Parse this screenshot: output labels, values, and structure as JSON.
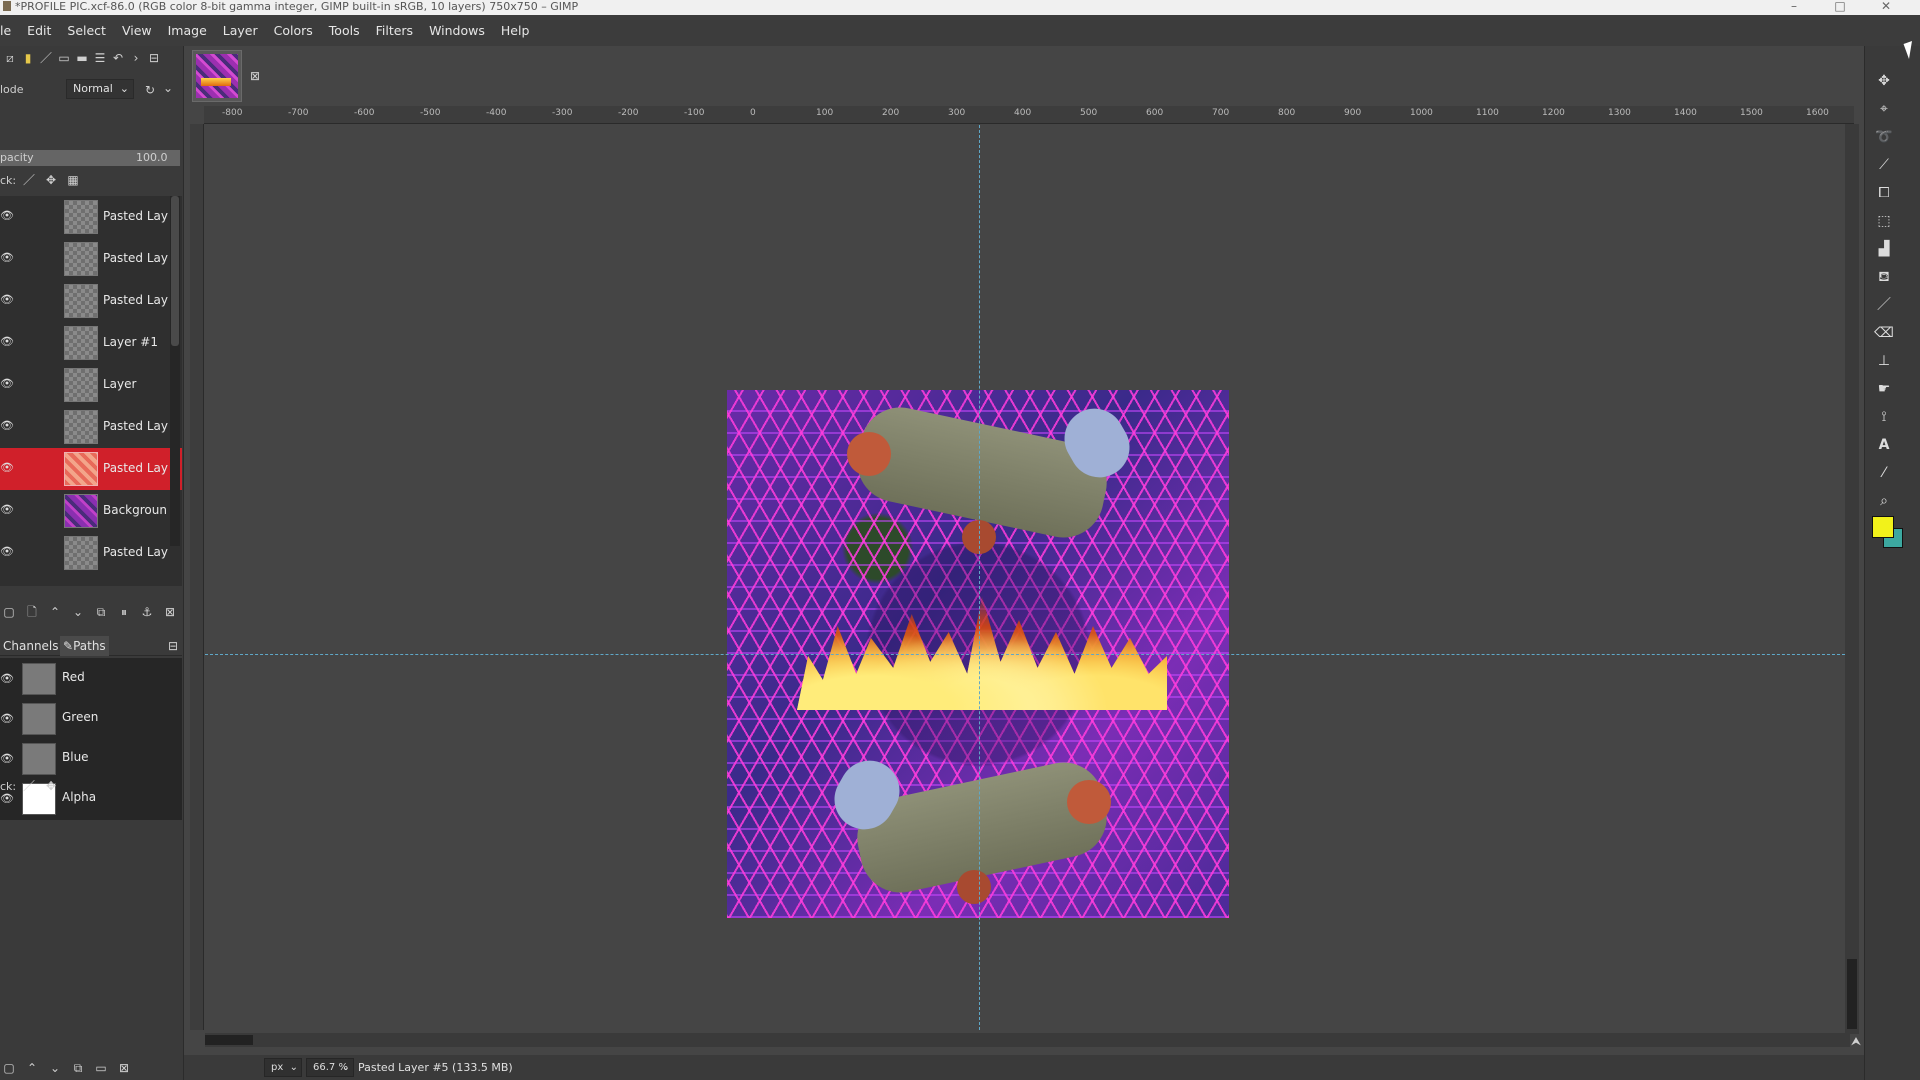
{
  "window": {
    "title": "*PROFILE PIC.xcf-86.0 (RGB color 8-bit gamma integer, GIMP built-in sRGB, 10 layers) 750x750 – GIMP",
    "controls": {
      "minimize": "–",
      "maximize": "□",
      "close": "✕"
    }
  },
  "menubar": {
    "items": [
      "le",
      "Edit",
      "Select",
      "View",
      "Image",
      "Layer",
      "Colors",
      "Tools",
      "Filters",
      "Windows",
      "Help"
    ]
  },
  "layers_panel": {
    "mode_label": "lode",
    "mode_value": "Normal",
    "opacity_label": "pacity",
    "opacity_value": "100.0",
    "opacity_fraction": 1.0,
    "lock_label": "ck:",
    "layers": [
      {
        "name": "Pasted Lay",
        "visible": true,
        "active": false
      },
      {
        "name": "Pasted Lay",
        "visible": true,
        "active": false
      },
      {
        "name": "Pasted Lay",
        "visible": true,
        "active": false
      },
      {
        "name": "Layer #1",
        "visible": true,
        "active": false
      },
      {
        "name": "Layer",
        "visible": true,
        "active": false
      },
      {
        "name": "Pasted Lay",
        "visible": true,
        "active": false
      },
      {
        "name": "Pasted Lay",
        "visible": true,
        "active": true
      },
      {
        "name": "Backgroun",
        "visible": true,
        "active": false
      },
      {
        "name": "Pasted Lay",
        "visible": true,
        "active": false
      }
    ]
  },
  "channels_panel": {
    "tabs": [
      "Channels",
      "Paths"
    ],
    "lock_label": "ck:",
    "channels": [
      {
        "name": "Red"
      },
      {
        "name": "Green"
      },
      {
        "name": "Blue"
      },
      {
        "name": "Alpha"
      }
    ]
  },
  "ruler": {
    "top_ticks": [
      "-800",
      "-700",
      "-600",
      "-500",
      "-400",
      "-300",
      "-200",
      "-100",
      "0",
      "100",
      "200",
      "300",
      "400",
      "500",
      "600",
      "700",
      "800",
      "900",
      "1000",
      "1100",
      "1200",
      "1300",
      "1400",
      "1500",
      "1600"
    ]
  },
  "statusbar": {
    "unit": "px",
    "zoom": "66.7 %",
    "message": "Pasted Layer #5 (133.5 MB)"
  },
  "colors": {
    "foreground": "#f2f21a",
    "background": "#3ca8a0",
    "active_layer": "#d0202a",
    "guide": "#5fa8c8"
  }
}
